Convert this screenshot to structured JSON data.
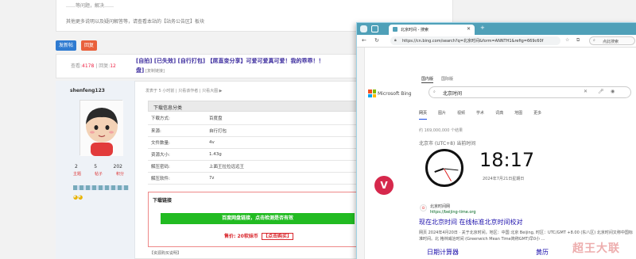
{
  "forum": {
    "notice_line": "其他更多说明以及疑问解答等，请查看本站的【站务公告区】板块",
    "notice_top": "……等问题，解决……",
    "buttons": {
      "post": "发新帖",
      "reply": "回复"
    },
    "stats": {
      "views_label": "查看:",
      "views": "4178",
      "sep": "|",
      "replies_label": "回复:",
      "replies": "12"
    },
    "title": "[自拍] [已失效] [自行打包] 【屌直变分享】可爱可爱真可爱！我的乖乖！！",
    "title_cont": "盘]",
    "title_tag": "[复制链接]",
    "user": {
      "name": "shenfeng123",
      "counts": [
        "2",
        "5",
        "202"
      ],
      "count_labels": [
        "主题",
        "帖子",
        "积分"
      ]
    },
    "meta": "发表于 5 小时前 | 只看该作者 | 只看大图 ▶",
    "section_title": "下载信息分类",
    "rows": [
      {
        "k": "下载方式:",
        "v": "百度盘"
      },
      {
        "k": "来源:",
        "v": "自行打包"
      },
      {
        "k": "文件数量:",
        "v": "4v"
      },
      {
        "k": "资源大小:",
        "v": "1.43g"
      },
      {
        "k": "解压密码:",
        "v": "上面王拉拉远远王"
      },
      {
        "k": "解压软件:",
        "v": "7z"
      }
    ],
    "download_heading": "下载链接",
    "green_btn": "百度网盘链接，点击检测是否有效",
    "price_label": "售价:",
    "price_value": "20软妹币",
    "buy_label": "【点击购买】",
    "footer": "【资源购买说明】"
  },
  "browser": {
    "tab_title": "北京时间 - 搜索",
    "url": "https://cn.bing.com/search?q=北京时间&form=ANNTH1&refig=669c60f",
    "ext_search": "点此搜索",
    "bing_logo": "Microsoft Bing",
    "scope_tabs": [
      "国内版",
      "国际版"
    ],
    "query": "北京时间",
    "nav_tabs": [
      "网页",
      "图片",
      "视频",
      "学术",
      "词典",
      "地图",
      "更多"
    ],
    "result_count": "约 169,000,000 个结果",
    "tz_label": "北京市 (UTC+8) 当前时间",
    "time": "18:17",
    "date": "2024年7月21日星期日",
    "site_name": "北京时间网",
    "site_url": "https://beijing-time.org",
    "result_title": "现在北京时间 在线标准北京时间校对",
    "snippet": "网页 2024年4月20日 · 关于北京时间，地区：中国 北京 Beijing, 时区：UTC/GMT +8.00 (东八区) 北京时间又称中国标准时间。北 格林威治时间 (Greenwich Mean Time简称GMT)早0小 ...",
    "sub_links": [
      "日期计算器",
      "黄历"
    ],
    "avatar_letter": "V"
  },
  "watermark": "超王大联",
  "colors": {
    "accent": "#4fa0b8",
    "link": "#1a0dab",
    "red": "#d9262c",
    "green": "#22bb22"
  }
}
